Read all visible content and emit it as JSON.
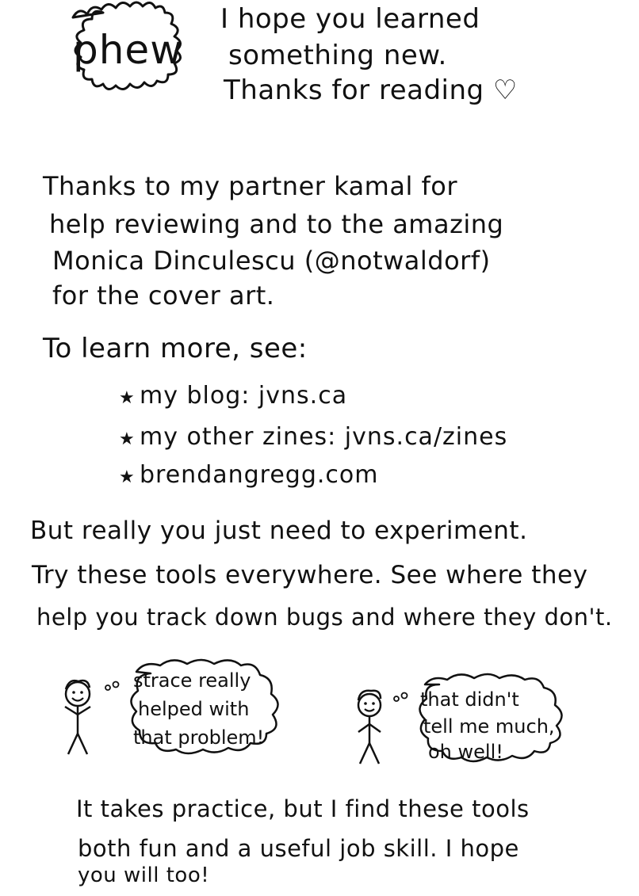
{
  "header": {
    "badge": "phew",
    "intro_lines": [
      "I hope you learned",
      "something new.",
      "Thanks for reading ♡"
    ]
  },
  "thanks_lines": [
    "Thanks to my partner kamal for",
    "help reviewing and to the amazing",
    "Monica Dinculescu (@notwaldorf)",
    "for the cover art."
  ],
  "learn_more": {
    "heading": "To learn more, see:",
    "items": [
      {
        "bullet": "★",
        "text": "my blog: jvns.ca"
      },
      {
        "bullet": "★",
        "text": "my other zines: jvns.ca/zines"
      },
      {
        "bullet": "★",
        "text": "brendangregg.com"
      }
    ]
  },
  "experiment_lines": [
    "But really you just need to experiment.",
    "Try these tools everywhere. See where they",
    "help you track down bugs and where they don't."
  ],
  "bubbles": {
    "left": [
      "strace really",
      "helped with",
      "that problem!"
    ],
    "right": [
      "that didn't",
      "tell me much,",
      "oh well!"
    ]
  },
  "closing_lines": [
    "It takes practice, but I find these tools",
    "both fun and a useful job skill. I hope",
    "you will too!"
  ]
}
